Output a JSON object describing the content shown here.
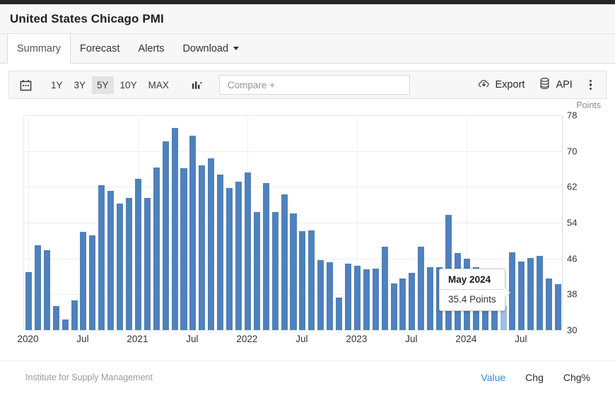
{
  "header": {
    "title": "United States Chicago PMI"
  },
  "tabs": [
    {
      "label": "Summary",
      "active": true,
      "caret": false
    },
    {
      "label": "Forecast",
      "active": false,
      "caret": false
    },
    {
      "label": "Alerts",
      "active": false,
      "caret": false
    },
    {
      "label": "Download",
      "active": false,
      "caret": true
    }
  ],
  "toolbar": {
    "calendar_icon": "calendar-icon",
    "ranges": [
      {
        "label": "1Y",
        "active": false
      },
      {
        "label": "3Y",
        "active": false
      },
      {
        "label": "5Y",
        "active": true
      },
      {
        "label": "10Y",
        "active": false
      },
      {
        "label": "MAX",
        "active": false
      }
    ],
    "charttype_icon": "bar-chart-icon",
    "compare_placeholder": "Compare +",
    "export_label": "Export",
    "export_icon": "cloud-download-icon",
    "api_label": "API",
    "api_icon": "database-icon",
    "more_icon": "kebab-menu-icon"
  },
  "footer": {
    "source": "Institute for Supply Management",
    "tabs": [
      {
        "label": "Value",
        "active": true
      },
      {
        "label": "Chg",
        "active": false
      },
      {
        "label": "Chg%",
        "active": false
      }
    ]
  },
  "tooltip": {
    "date": "May 2024",
    "value": "35.4 Points"
  },
  "colors": {
    "bar": "#4f81bd",
    "bar_highlight": "#9cc0e0",
    "accent": "#2f8fe0",
    "toolbar_bg": "#f7f7f7"
  },
  "chart_data": {
    "type": "bar",
    "title": "United States Chicago PMI",
    "unit_label": "Points",
    "xlabel": "",
    "ylabel": "Points",
    "ylim": [
      30,
      78
    ],
    "yticks": [
      78,
      70,
      62,
      54,
      46,
      38,
      30
    ],
    "grid": true,
    "legend_position": "none",
    "xtick_labels": [
      "2020",
      "Jul",
      "2021",
      "Jul",
      "2022",
      "Jul",
      "2023",
      "Jul",
      "2024",
      "Jul"
    ],
    "xtick_indices": [
      0,
      6,
      12,
      18,
      24,
      30,
      36,
      42,
      48,
      54
    ],
    "highlight_index": 52,
    "annotation": {
      "date": "May 2024",
      "value": 35.4,
      "text": "35.4 Points"
    },
    "categories": [
      "Jan 2020",
      "Feb 2020",
      "Mar 2020",
      "Apr 2020",
      "May 2020",
      "Jun 2020",
      "Jul 2020",
      "Aug 2020",
      "Sep 2020",
      "Oct 2020",
      "Nov 2020",
      "Dec 2020",
      "Jan 2021",
      "Feb 2021",
      "Mar 2021",
      "Apr 2021",
      "May 2021",
      "Jun 2021",
      "Jul 2021",
      "Aug 2021",
      "Sep 2021",
      "Oct 2021",
      "Nov 2021",
      "Dec 2021",
      "Jan 2022",
      "Feb 2022",
      "Mar 2022",
      "Apr 2022",
      "May 2022",
      "Jun 2022",
      "Jul 2022",
      "Aug 2022",
      "Sep 2022",
      "Oct 2022",
      "Nov 2022",
      "Dec 2022",
      "Jan 2023",
      "Feb 2023",
      "Mar 2023",
      "Apr 2023",
      "May 2023",
      "Jun 2023",
      "Jul 2023",
      "Aug 2023",
      "Sep 2023",
      "Oct 2023",
      "Nov 2023",
      "Dec 2023",
      "Jan 2024",
      "Feb 2024",
      "Mar 2024",
      "Apr 2024",
      "May 2024",
      "Jun 2024",
      "Jul 2024",
      "Aug 2024",
      "Sep 2024",
      "Oct 2024",
      "Nov 2024"
    ],
    "values": [
      42.9,
      49.0,
      47.8,
      35.4,
      32.3,
      36.6,
      51.9,
      51.2,
      62.4,
      61.1,
      58.2,
      59.5,
      63.8,
      59.5,
      66.3,
      72.1,
      75.2,
      66.1,
      73.4,
      66.8,
      68.4,
      64.7,
      61.8,
      63.1,
      65.2,
      56.3,
      62.9,
      56.4,
      60.3,
      56.0,
      52.1,
      52.2,
      45.7,
      45.2,
      37.2,
      44.9,
      44.3,
      43.6,
      43.8,
      48.6,
      40.4,
      41.5,
      42.8,
      48.7,
      44.0,
      44.0,
      55.8,
      47.2,
      46.0,
      44.0,
      41.4,
      37.9,
      35.4,
      47.4,
      45.3,
      46.1,
      46.6,
      41.6,
      40.2
    ]
  }
}
